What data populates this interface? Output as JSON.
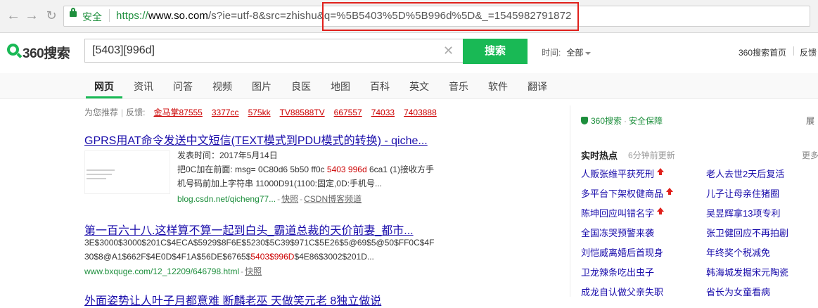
{
  "browser": {
    "back_icon": "back-arrow-icon",
    "forward_icon": "forward-arrow-icon",
    "reload_icon": "reload-icon",
    "secure_label": "安全",
    "url_proto": "https://",
    "url_host": "www.so.com",
    "url_rest": "/s?ie=utf-8&src=zhishu&q=%5B5403%5D%5B996d%5D&_=1545982791872"
  },
  "header": {
    "logo_text": "360搜索",
    "search_value": "[5403][996d]",
    "search_button": "搜索",
    "time_label": "时间:",
    "time_value": "全部",
    "home_link": "360搜索首页",
    "feedback_link": "反馈"
  },
  "tabs": [
    {
      "label": "网页",
      "active": true
    },
    {
      "label": "资讯"
    },
    {
      "label": "问答"
    },
    {
      "label": "视频"
    },
    {
      "label": "图片"
    },
    {
      "label": "良医"
    },
    {
      "label": "地图"
    },
    {
      "label": "百科"
    },
    {
      "label": "英文"
    },
    {
      "label": "音乐"
    },
    {
      "label": "软件"
    },
    {
      "label": "翻译"
    }
  ],
  "recommend": {
    "label": "为您推荐",
    "sep": "|",
    "feedback": "反馈:",
    "items": [
      "金马掌87555",
      "3377cc",
      "575kk",
      "TV88588TV",
      "667557",
      "74033",
      "7403888"
    ]
  },
  "results": [
    {
      "title": "GPRS用AT命令发送中文短信(TEXT模式到PDU模式的转换) - qiche...",
      "date": "发表时间：2017年5月14日",
      "line1_pre": "把0C加在前面: msg= 0C80d6 5b50 ff0c ",
      "line1_hl": "5403 996d",
      "line1_post": " 6ca1 (1)接收方手",
      "line2": "机号码前加上字符串 11000D91(1100:固定,0D:手机号...",
      "url": "blog.csdn.net/qicheng77...",
      "snapshot": "快照",
      "source": "CSDN博客频道"
    },
    {
      "title": "第一百六十八.这样算不算一起到白头_霸道总裁的天价前妻_都市...",
      "line1": "3E$3000$3000$201C$4ECA$5929$8F6E$5230$5C39$971C$5E26$5@69$5@50$FF0C$4F",
      "line2_pre": "30$8@A1$662F$4E0D$4F1A$56DE$6765$",
      "line2_hl": "5403$996D",
      "line2_post": "$4E86$3002$201D...",
      "url": "www.bxquge.com/12_12209/646798.html",
      "snapshot": "快照"
    },
    {
      "title": "外面姿势让人叶子月都意难 断麟老巫 天做笑元老 8独立做说"
    }
  ],
  "sidebar": {
    "safe_label": "360搜索",
    "safe_dot": "·",
    "safe_text": "安全保障",
    "zhan": "展",
    "hot_title": "实时热点",
    "hot_updated": "6分钟前更新",
    "more": "更多",
    "left_items": [
      {
        "text": "人贩张维平获死刑",
        "up": true
      },
      {
        "text": "多平台下架权健商品",
        "up": true
      },
      {
        "text": "陈坤回应叫错名字",
        "up": true
      },
      {
        "text": "全国冻哭预警来袭",
        "up": false
      },
      {
        "text": "刘恺威离婚后首现身",
        "up": false
      },
      {
        "text": "卫龙辣条吃出虫子",
        "up": false
      },
      {
        "text": "成龙自认做父亲失职",
        "up": false
      }
    ],
    "right_items": [
      "老人去世2天后复活",
      "儿子让母亲住猪圈",
      "吴昱辉拿13项专利",
      "张卫健回应不再拍剧",
      "年终奖个税减免",
      "韩海城发掘宋元陶瓷",
      "省长为女童看病"
    ]
  }
}
